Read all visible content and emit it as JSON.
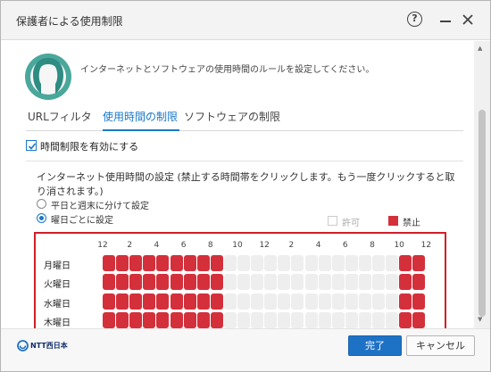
{
  "window": {
    "title": "保護者による使用制限"
  },
  "intro_text": "インターネットとソフトウェアの使用時間のルールを設定してください。",
  "tabs": [
    {
      "label": "URLフィルタ",
      "active": false
    },
    {
      "label": "使用時間の制限",
      "active": true
    },
    {
      "label": "ソフトウェアの制限",
      "active": false
    }
  ],
  "time_limit": {
    "enable_label": "時間制限を有効にする",
    "enabled": true,
    "description": "インターネット使用時間の設定 (禁止する時間帯をクリックします。もう一度クリックすると取り消されます。)",
    "radio_options": [
      {
        "label": "平日と週末に分けて設定",
        "selected": false
      },
      {
        "label": "曜日ごとに設定",
        "selected": true
      }
    ]
  },
  "legend": {
    "allow_label": "許可",
    "deny_label": "禁止",
    "allow_color": "#eeeeee",
    "deny_color": "#d4303b"
  },
  "grid": {
    "hour_labels": [
      "12",
      "2",
      "4",
      "6",
      "8",
      "10",
      "12",
      "2",
      "4",
      "6",
      "8",
      "10",
      "12"
    ],
    "rows": [
      {
        "day": "月曜日",
        "blocked_hours": [
          0,
          1,
          2,
          3,
          4,
          5,
          6,
          7,
          8,
          22,
          23
        ]
      },
      {
        "day": "火曜日",
        "blocked_hours": [
          0,
          1,
          2,
          3,
          4,
          5,
          6,
          7,
          8,
          22,
          23
        ]
      },
      {
        "day": "水曜日",
        "blocked_hours": [
          0,
          1,
          2,
          3,
          4,
          5,
          6,
          7,
          8,
          22,
          23
        ]
      },
      {
        "day": "木曜日",
        "blocked_hours": [
          0,
          1,
          2,
          3,
          4,
          5,
          6,
          7,
          8,
          22,
          23
        ]
      }
    ]
  },
  "footer": {
    "logo_text": "NTT西日本",
    "ok_label": "完了",
    "cancel_label": "キャンセル"
  },
  "colors": {
    "accent": "#1878c8",
    "primary_button": "#1e72c6",
    "grid_frame": "#d11f28"
  }
}
